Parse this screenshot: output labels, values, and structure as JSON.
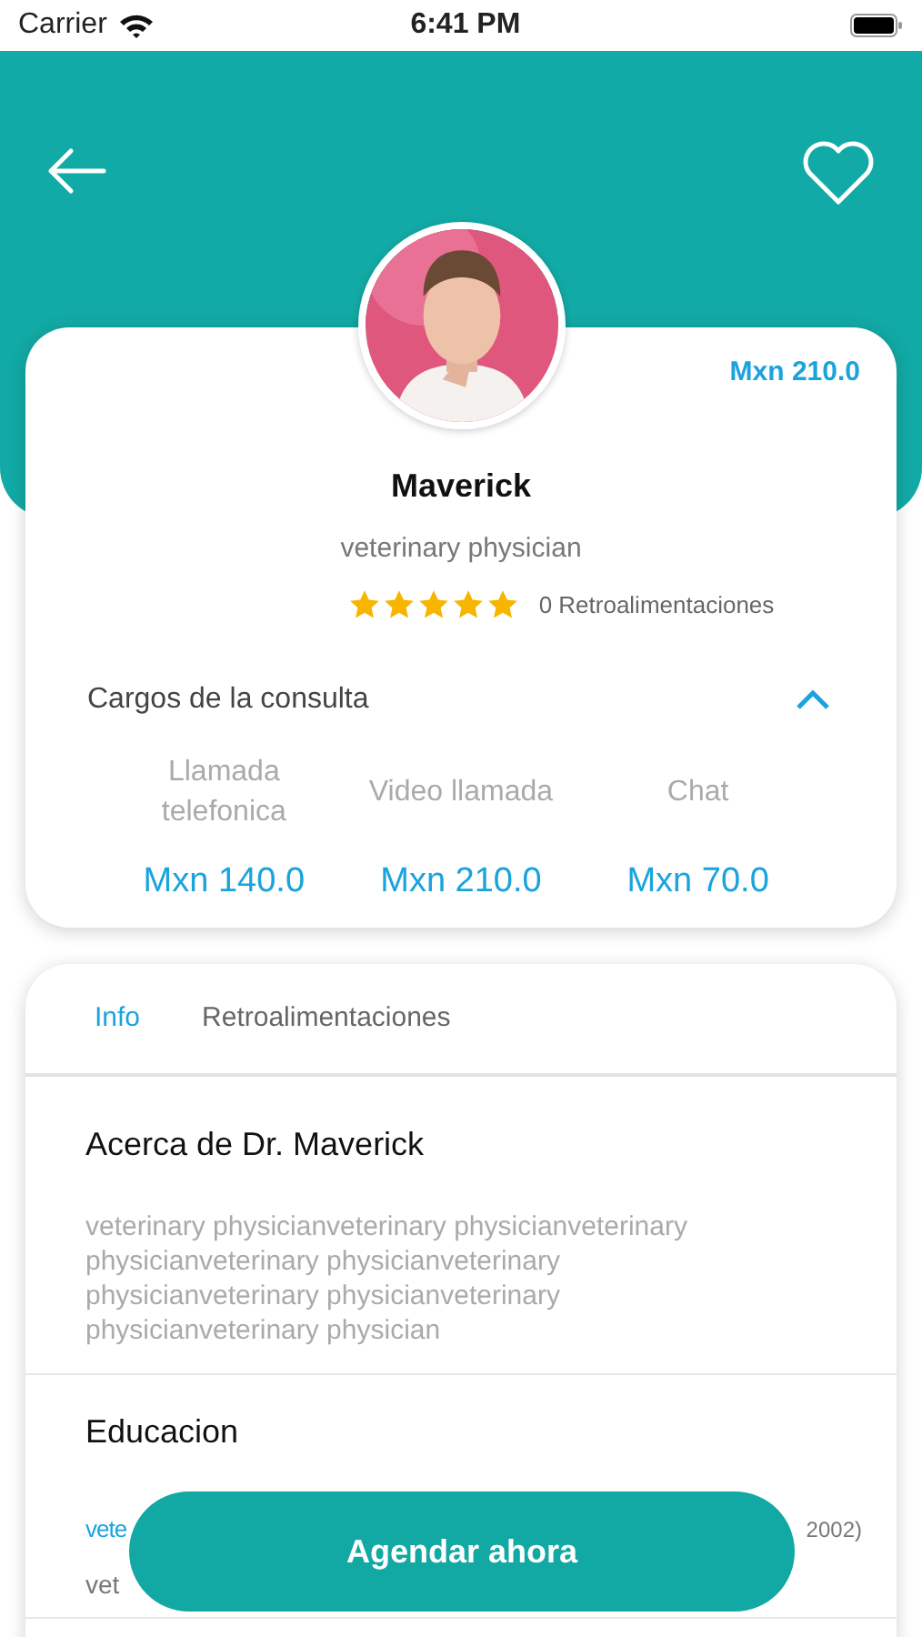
{
  "status_bar": {
    "carrier": "Carrier",
    "time": "6:41 PM"
  },
  "header": {
    "favorite": false
  },
  "doctor": {
    "price": "Mxn 210.0",
    "name": "Maverick",
    "specialty": "veterinary physician",
    "stars": 5,
    "feedback_count": "0 Retroalimentaciones"
  },
  "charges": {
    "title": "Cargos de la consulta",
    "expanded": true,
    "items": [
      {
        "label": "Llamada telefonica",
        "price": "Mxn 140.0"
      },
      {
        "label": "Video llamada",
        "price": "Mxn 210.0"
      },
      {
        "label": "Chat",
        "price": "Mxn 70.0"
      }
    ]
  },
  "tabs": [
    {
      "label": "Info",
      "selected": true
    },
    {
      "label": "Retroalimentaciones",
      "selected": false
    }
  ],
  "about": {
    "title": "Acerca de Dr. Maverick",
    "text": "veterinary physicianveterinary physicianveterinary physicianveterinary physicianveterinary physicianveterinary physicianveterinary physicianveterinary physician"
  },
  "education": {
    "title": "Educacion",
    "entries": [
      {
        "degree": "vete",
        "year": "2002)",
        "school": "vet"
      }
    ]
  },
  "cta": {
    "label": "Agendar ahora"
  }
}
